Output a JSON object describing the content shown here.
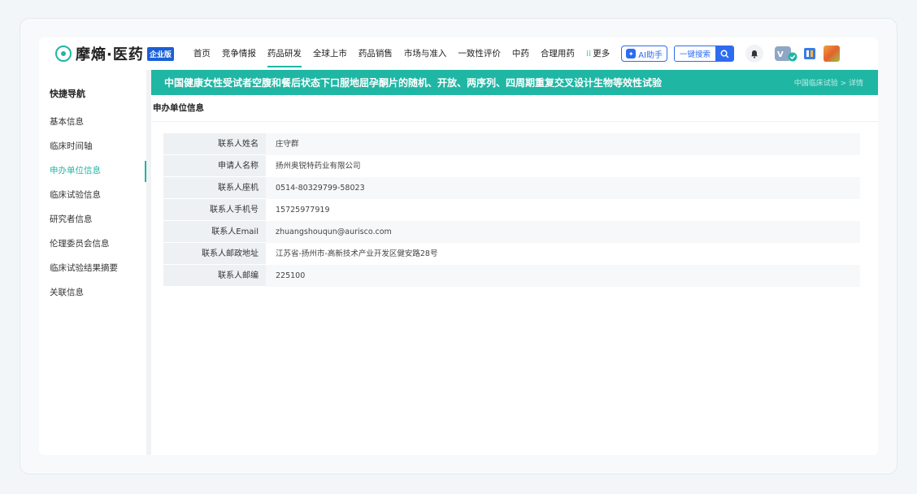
{
  "header": {
    "logo_text": "摩熵·医药",
    "edition": "企业版",
    "nav": [
      "首页",
      "竞争情报",
      "药品研发",
      "全球上市",
      "药品销售",
      "市场与准入",
      "一致性评价",
      "中药",
      "合理用药"
    ],
    "more_label": "更多",
    "ai_label": "AI助手",
    "search_label": "一键搜索"
  },
  "sidebar": {
    "title": "快捷导航",
    "items": [
      "基本信息",
      "临床时间轴",
      "申办单位信息",
      "临床试验信息",
      "研究者信息",
      "伦理委员会信息",
      "临床试验结果摘要",
      "关联信息"
    ]
  },
  "main": {
    "title": "中国健康女性受试者空腹和餐后状态下口服地屈孕酮片的随机、开放、两序列、四周期重复交叉设计生物等效性试验",
    "breadcrumb": "中国临床试验 > 详情",
    "section_title": "申办单位信息",
    "rows": [
      {
        "label": "联系人姓名",
        "value": "庄守群"
      },
      {
        "label": "申请人名称",
        "value": "扬州奥锐特药业有限公司"
      },
      {
        "label": "联系人座机",
        "value": "0514-80329799-58023"
      },
      {
        "label": "联系人手机号",
        "value": "15725977919"
      },
      {
        "label": "联系人Email",
        "value": "zhuangshouqun@aurisco.com"
      },
      {
        "label": "联系人邮政地址",
        "value": "江苏省-扬州市-高新技术产业开发区健安路28号"
      },
      {
        "label": "联系人邮编",
        "value": "225100"
      }
    ]
  },
  "colors": {
    "accent": "#20b6a4",
    "primary_blue": "#2c6cf0"
  }
}
